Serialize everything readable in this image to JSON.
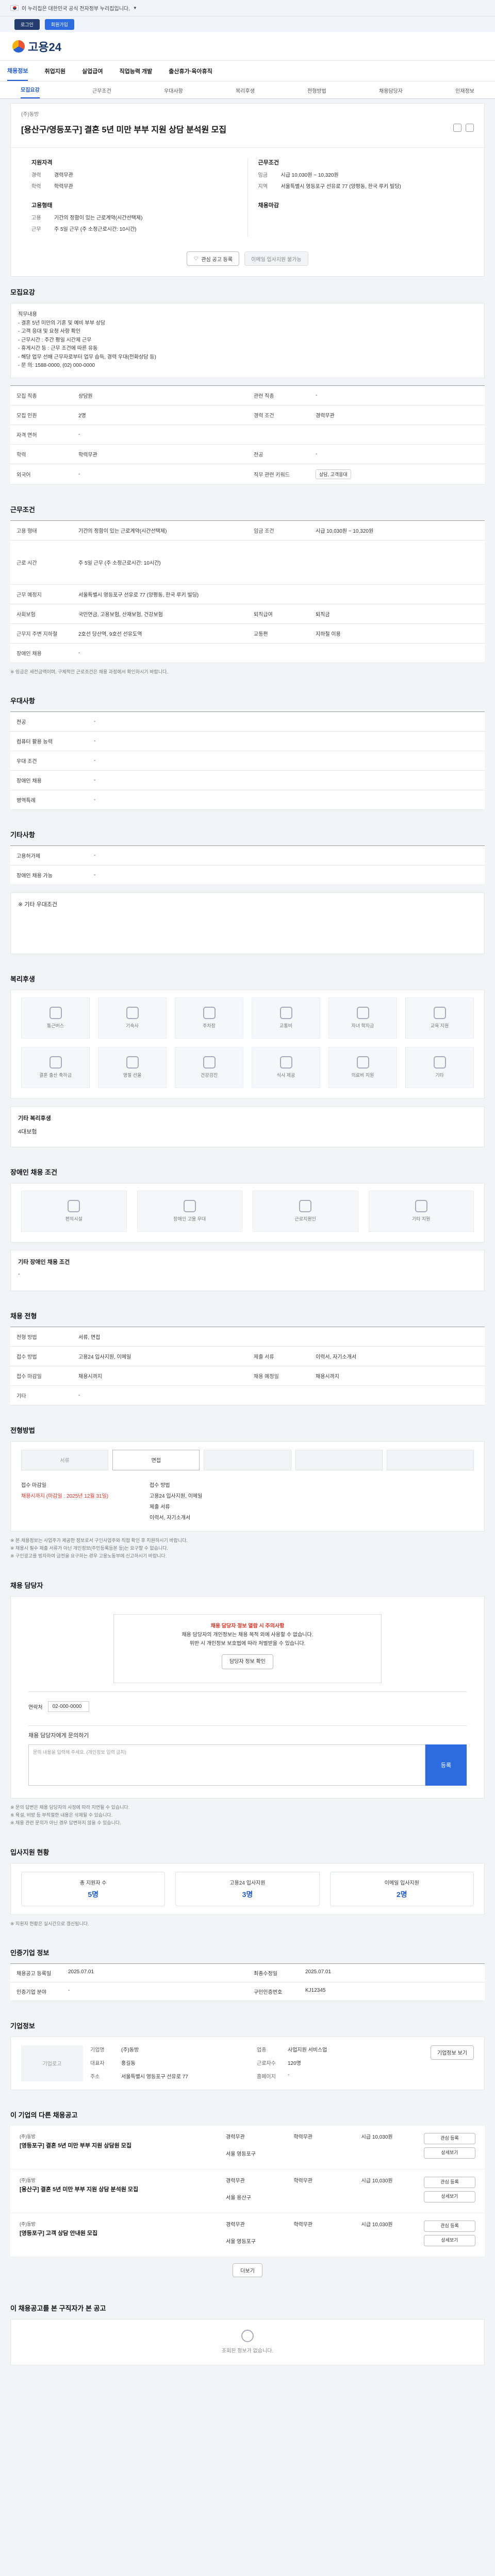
{
  "gov": {
    "text": "이 누리집은 대한민국 공식 전자정부 누리집입니다."
  },
  "subbar": {
    "a": "로그인",
    "b": "회원가입"
  },
  "header": {
    "logo": "고용24"
  },
  "menu": [
    "채용정보",
    "취업지원",
    "실업급여",
    "직업능력 개발",
    "출산휴가·육아휴직"
  ],
  "tabs": [
    "모집요강",
    "근무조건",
    "우대사항",
    "복리후생",
    "전형방법",
    "채용담당자",
    "인재정보"
  ],
  "title": {
    "bc": "(주)동방",
    "job": "[용산구/영등포구] 결혼 5년 미만 부부 지원 상담 분석원 모집"
  },
  "summary": {
    "c1_title": "지원자격",
    "c1": [
      {
        "k": "경력",
        "v": "경력무관"
      },
      {
        "k": "학력",
        "v": "학력무관"
      }
    ],
    "c2_title": "근무조건",
    "c2": [
      {
        "k": "임금",
        "v": "시급 10,030원 ~ 10,320원"
      },
      {
        "k": "지역",
        "v": "서울특별시 영등포구 선유로 77 (양평동, 한국 루키 빌딩)"
      }
    ],
    "c3_title": "고용형태",
    "c3": [
      {
        "k": "고용",
        "v": "기간의 정함이 있는 근로계약(시간선택제)"
      },
      {
        "k": "근무",
        "v": "주 5일 근무 (주 소정근로시간: 10시간)"
      }
    ],
    "c4_title": "채용마감",
    "btn1": "관심 공고 등록",
    "btn2": "이메일 입사지원 불가능"
  },
  "desc": {
    "h": "모집요강",
    "body": "직무내용\n- 결혼 5년 미만의 기혼 및 예비 부부 상담\n- 고객 응대 및 요청 사항 확인\n- 근무시간 : 주간 평일 시간제 근무\n- 휴게시간 등 : 근무 조건에 따른 유동\n- 해당 업무 선배 근무자로부터 업무 습득, 경력 우대(전화상담 등)\n- 문 의: 1588-0000, (02) 000-0000"
  },
  "job_table": [
    {
      "k": "모집 직종",
      "v": "상담원"
    },
    {
      "k": "관련 직종",
      "v": "-"
    },
    {
      "k": "모집 인원",
      "v": "2명"
    },
    {
      "k": "경력 조건",
      "v": "경력무관"
    },
    {
      "k": "자격 면허",
      "v": "-"
    },
    {
      "k": "학력",
      "v": "학력무관"
    },
    {
      "k": "전공",
      "v": "-"
    },
    {
      "k": "외국어",
      "v": "-"
    },
    {
      "k": "직무 관련 키워드",
      "v": "상담, 고객응대"
    }
  ],
  "work": {
    "h": "근무조건",
    "rows": [
      {
        "k": "고용 형태",
        "v": "기간의 정함이 있는 근로계약(시간선택제)",
        "k2": "임금 조건",
        "v2": "시급 10,030원 ~ 10,320원"
      },
      {
        "k": "근로 시간",
        "v": "주 5일 근무 (주 소정근로시간: 10시간)",
        "k2": "",
        "v2": ""
      },
      {
        "k": "근무 예정지",
        "v": "서울특별시 영등포구 선유로 77 (양평동, 한국 루키 빌딩)",
        "k2": "",
        "v2": ""
      },
      {
        "k": "사회보험",
        "v": "국민연금, 고용보험, 산재보험, 건강보험",
        "k2": "퇴직급여",
        "v2": "퇴직금"
      },
      {
        "k": "근무지 주변 지하철",
        "v": "2호선 당산역, 9호선 선유도역",
        "k2": "교통편",
        "v2": "지하철 이용"
      },
      {
        "k": "장애인 채용",
        "v": "-",
        "k2": "",
        "v2": ""
      }
    ],
    "note": "※ 임금은 세전금액이며, 구체적인 근로조건은 채용 과정에서 확인하시기 바랍니다."
  },
  "pref": {
    "h": "우대사항",
    "rows": [
      {
        "k": "전공",
        "v": "-"
      },
      {
        "k": "컴퓨터 활용 능력",
        "v": "-"
      },
      {
        "k": "우대 조건",
        "v": "-"
      },
      {
        "k": "장애인 채용",
        "v": "-"
      },
      {
        "k": "병역특례",
        "v": "-"
      }
    ]
  },
  "etc": {
    "h": "기타사항",
    "rows": [
      {
        "k": "고용허가제",
        "v": "-"
      },
      {
        "k": "장애인 채용 가능",
        "v": "-"
      }
    ],
    "note": "※ 기타 우대조건"
  },
  "welfare": {
    "h": "복리후생",
    "items": [
      "통근버스",
      "기숙사",
      "주차장",
      "교통비",
      "자녀 학자금",
      "교육 지원",
      "결혼 출산 축하금",
      "명절 선물",
      "건강검진",
      "식사 제공",
      "의료비 지원",
      "기타"
    ],
    "sub": "기타 복리후생",
    "subv": "4대보험"
  },
  "disab": {
    "h": "장애인 채용 조건",
    "items": [
      "편의시설",
      "장애인 고용 우대",
      "근로지원인",
      "기타 지원"
    ],
    "sub": "기타 장애인 채용 조건",
    "subv": "-"
  },
  "recruit": {
    "h": "채용 전형",
    "rows": [
      {
        "k": "전형 방법",
        "v": "서류, 면접",
        "k2": "",
        "v2": ""
      },
      {
        "k": "접수 방법",
        "v": "고용24 입사지원, 이메일",
        "k2": "제출 서류",
        "v2": "이력서, 자기소개서"
      },
      {
        "k": "접수 마감일",
        "v": "채용시까지",
        "k2": "채용 예정일",
        "v2": "채용시까지"
      },
      {
        "k": "기타",
        "v": "-",
        "k2": "",
        "v2": ""
      }
    ]
  },
  "process": {
    "h": "전형방법",
    "steps": [
      "서류",
      "면접",
      "",
      "",
      ""
    ],
    "left_k": "접수 마감일",
    "left_v": "채용시까지 (마감일 : 2025년 12월 31일)",
    "right_k": "접수 방법",
    "right_v": "고용24 입사지원, 이메일",
    "right_k2": "제출 서류",
    "right_v2": "이력서, 자기소개서",
    "notes": [
      "※ 본 채용정보는 사업주가 제공한 정보로서 구인사업주와 직접 확인 후 지원하시기 바랍니다.",
      "※ 채용시 필수 제출 서류가 아닌 개인정보(주민등록등본 등)는 요구할 수 없습니다.",
      "※ 구인광고를 빙자하여 금전을 요구하는 경우 고용노동부에 신고하시기 바랍니다."
    ]
  },
  "contact": {
    "h": "채용 담당자",
    "box_t": "채용 담당자 정보 열람 시 주의사항",
    "box_l1": "채용 담당자의 개인정보는 채용 목적 외에 사용할 수 없습니다.",
    "box_l2": "위반 시 개인정보 보호법에 따라 처벌받을 수 있습니다.",
    "box_btn": "담당자 정보 확인",
    "k1": "연락처",
    "v1": "02-000-0000",
    "inq_h": "채용 담당자에게 문의하기",
    "inq_ph": "문의 내용을 입력해 주세요. (개인정보 입력 금지)",
    "inq_btn": "등록",
    "notes": [
      "※ 문의 답변은 채용 담당자의 사정에 따라 지연될 수 있습니다.",
      "※ 욕설, 비방 등 부적절한 내용은 삭제될 수 있습니다.",
      "※ 채용 관련 문의가 아닌 경우 답변하지 않을 수 있습니다."
    ]
  },
  "stats": {
    "h": "입사지원 현황",
    "items": [
      {
        "k": "총 지원자 수",
        "v": "5명"
      },
      {
        "k": "고용24 입사지원",
        "v": "3명"
      },
      {
        "k": "이메일 입사지원",
        "v": "2명"
      }
    ],
    "note": "※ 지원자 현황은 실시간으로 갱신됩니다."
  },
  "info": {
    "h": "인증기업 정보",
    "rows": [
      {
        "k": "채용공고 등록일",
        "v": "2025.07.01",
        "k2": "최종수정일",
        "v2": "2025.07.01"
      },
      {
        "k": "인증기업 분야",
        "v": "-",
        "k2": "구인인증번호",
        "v2": "KJ12345"
      }
    ]
  },
  "company": {
    "h": "기업정보",
    "logo": "기업로고",
    "rows": [
      {
        "k": "기업명",
        "v": "(주)동방"
      },
      {
        "k": "업종",
        "v": "사업지원 서비스업"
      },
      {
        "k": "대표자",
        "v": "홍길동"
      },
      {
        "k": "근로자수",
        "v": "120명"
      },
      {
        "k": "주소",
        "v": "서울특별시 영등포구 선유로 77"
      },
      {
        "k": "홈페이지",
        "v": "-"
      }
    ],
    "btn": "기업정보 보기"
  },
  "similar": {
    "h": "이 기업의 다른 채용공고",
    "items": [
      {
        "co": "(주)동방",
        "ti": "[영등포구] 결혼 5년 미만 부부 지원 상담원 모집",
        "a": "경력무관",
        "b": "학력무관",
        "c": "시급 10,030원",
        "d": "서울 영등포구",
        "b1": "관심 등록",
        "b2": "상세보기"
      },
      {
        "co": "(주)동방",
        "ti": "[용산구] 결혼 5년 미만 부부 지원 상담 분석원 모집",
        "a": "경력무관",
        "b": "학력무관",
        "c": "시급 10,030원",
        "d": "서울 용산구",
        "b1": "관심 등록",
        "b2": "상세보기"
      },
      {
        "co": "(주)동방",
        "ti": "[영등포구] 고객 상담 안내원 모집",
        "a": "경력무관",
        "b": "학력무관",
        "c": "시급 10,030원",
        "d": "서울 영등포구",
        "b1": "관심 등록",
        "b2": "상세보기"
      }
    ],
    "more": "더보기"
  },
  "recommend": {
    "h": "이 채용공고를 본 구직자가 본 공고",
    "empty": "조회된 정보가 없습니다."
  }
}
